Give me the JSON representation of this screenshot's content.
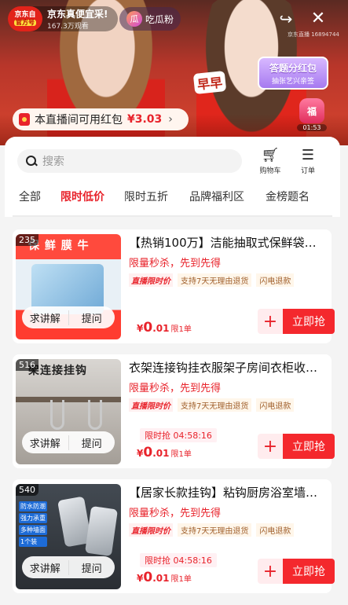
{
  "stream": {
    "shop_name": "京东真便宜采!",
    "shop_badge_top": "京东自",
    "shop_badge_tag": "官方号",
    "viewers": "167.3万观看",
    "fans_label": "吃瓜粉",
    "room_id": "京东直播 16894744",
    "qa_title": "答题分红包",
    "qa_sub": "抽张艺兴亲签",
    "sign_text": "早早",
    "lucky_bag_label": "福",
    "lucky_bag_timer": "01:53",
    "redpack_text": "本直播间可用红包",
    "redpack_amount": "¥3.03"
  },
  "toolbar": {
    "search_placeholder": "搜索",
    "cart_label": "购物车",
    "orders_label": "订单"
  },
  "tabs": [
    "全部",
    "限时低价",
    "限时五折",
    "品牌福利区",
    "金榜题名"
  ],
  "products": [
    {
      "badge": "235",
      "image_text": "保 鲜 膜 牛",
      "title": "【热销100万】洁能抽取式保鲜袋…",
      "promo": "限量秒杀，先到先得",
      "tag_live": "直播限时价",
      "tag_return": "支持7天无理由退货",
      "tag_refund": "闪电退款",
      "timer": "",
      "price_currency": "¥",
      "price_int": "0",
      "price_dec": ".01",
      "limit": "限1单",
      "btn_ask": "求讲解",
      "btn_question": "提问",
      "buy_label": "立即抢"
    },
    {
      "badge": "516",
      "image_text": "架连接挂钩",
      "title": "衣架连接钩挂衣服架子房间衣柜收…",
      "promo": "限量秒杀，先到先得",
      "tag_live": "直播限时价",
      "tag_return": "支持7天无理由退货",
      "tag_refund": "闪电退款",
      "timer": "限时抢 04:58:16",
      "price_currency": "¥",
      "price_int": "0",
      "price_dec": ".01",
      "limit": "限1单",
      "btn_ask": "求讲解",
      "btn_question": "提问",
      "buy_label": "立即抢"
    },
    {
      "badge": "540",
      "image_text": "",
      "image_tags": [
        "防水防潮",
        "强力承重",
        "多种墙面",
        "1个装"
      ],
      "title": "【居家长款挂钩】粘钩厨房浴室墙…",
      "promo": "限量秒杀，先到先得",
      "tag_live": "直播限时价",
      "tag_return": "支持7天无理由退货",
      "tag_refund": "闪电退款",
      "timer": "限时抢 04:58:16",
      "price_currency": "¥",
      "price_int": "0",
      "price_dec": ".01",
      "limit": "限1单",
      "btn_ask": "求讲解",
      "btn_question": "提问",
      "buy_label": "立即抢"
    }
  ],
  "colors": {
    "accent": "#e8232b",
    "buy_button": "#f4282d"
  }
}
